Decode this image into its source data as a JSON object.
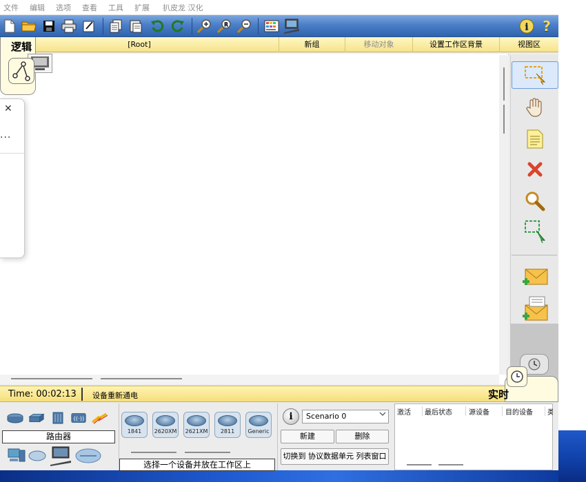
{
  "menu": {
    "items": [
      "文件",
      "编辑",
      "选项",
      "查看",
      "工具",
      "扩展",
      "扒皮龙 汉化"
    ]
  },
  "toolbar": {
    "icons": [
      "new-file-icon",
      "open-folder-icon",
      "save-icon",
      "print-icon",
      "activity-wizard-icon",
      "copy-icon",
      "paste-icon",
      "undo-icon",
      "redo-icon",
      "zoom-in-icon",
      "zoom-reset-icon",
      "zoom-out-icon",
      "palette-icon",
      "custom-device-icon",
      "info-icon",
      "help-icon"
    ],
    "help_label": "?"
  },
  "workspace_bar": {
    "logic_tab": "逻辑",
    "root": "[Root]",
    "new_cluster": "新组",
    "move_object": "移动对象",
    "set_background": "设置工作区背景",
    "viewport": "视图区"
  },
  "right_palette": {
    "tools": [
      "select-icon",
      "hand-move-icon",
      "note-icon",
      "delete-icon",
      "inspect-icon",
      "resize-shape-icon",
      "add-simple-pdu-icon",
      "add-complex-pdu-icon"
    ]
  },
  "status": {
    "time": "Time: 00:02:13",
    "power_cycle": "设备重新通电",
    "realtime": "实时"
  },
  "device_panel": {
    "category_label": "路由器",
    "hint": "选择一个设备并放在工作区上",
    "models": [
      "1841",
      "2620XM",
      "2621XM",
      "2811",
      "Generic"
    ]
  },
  "scenario": {
    "selected": "Scenario 0",
    "new_button": "新建",
    "delete_button": "删除",
    "toggle_pdu_button": "切换到 协议数据单元 列表窗口"
  },
  "event_list": {
    "columns": [
      "激活",
      "最后状态",
      "源设备",
      "目的设备",
      "类"
    ]
  },
  "dialog": {
    "close": "✕",
    "ellipsis": "..."
  },
  "colors": {
    "toolbar_blue": "#4b7fc8",
    "workspace_bar_yellow": "#f6e38a",
    "delete_red": "#d9452c"
  }
}
